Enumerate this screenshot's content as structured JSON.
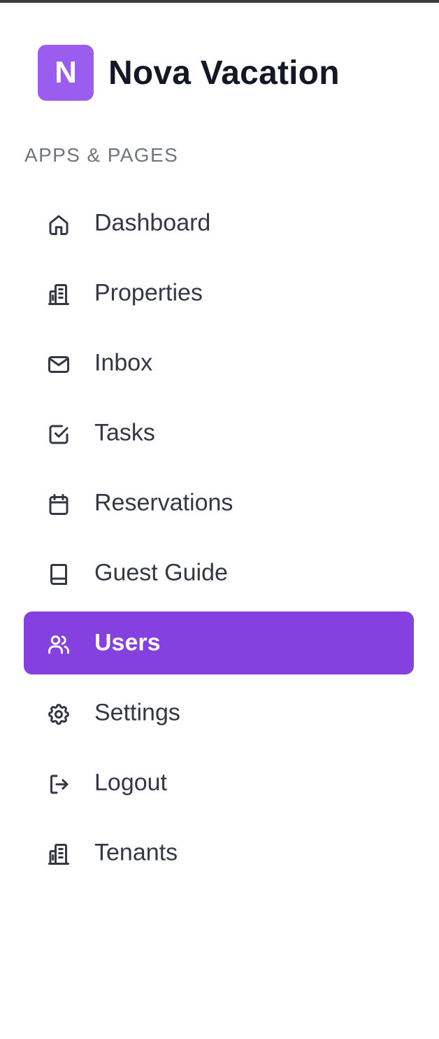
{
  "brand": {
    "logo_letter": "N",
    "name": "Nova Vacation"
  },
  "section_label": "APPS & PAGES",
  "nav": {
    "items": [
      {
        "label": "Dashboard",
        "icon": "home-icon"
      },
      {
        "label": "Properties",
        "icon": "building-icon"
      },
      {
        "label": "Inbox",
        "icon": "mail-icon"
      },
      {
        "label": "Tasks",
        "icon": "checkbox-icon"
      },
      {
        "label": "Reservations",
        "icon": "calendar-icon"
      },
      {
        "label": "Guest Guide",
        "icon": "book-icon"
      },
      {
        "label": "Users",
        "icon": "users-icon",
        "active": true
      },
      {
        "label": "Settings",
        "icon": "gear-icon"
      },
      {
        "label": "Logout",
        "icon": "logout-icon"
      },
      {
        "label": "Tenants",
        "icon": "building-icon"
      }
    ]
  },
  "colors": {
    "accent": "#8540e0",
    "logo_bg": "#9b5cf0",
    "text": "#323846",
    "muted": "#6f7480"
  }
}
